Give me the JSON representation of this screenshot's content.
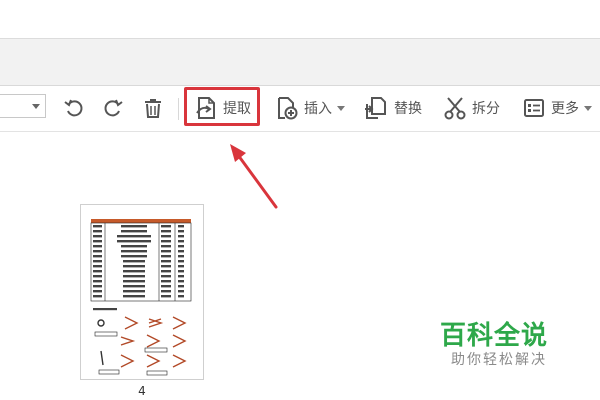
{
  "toolbar": {
    "extract_label": "提取",
    "insert_label": "插入",
    "replace_label": "替换",
    "split_label": "拆分",
    "more_label": "更多"
  },
  "thumbnail": {
    "page_number": "4"
  },
  "watermark": {
    "title": "百科全说",
    "subtitle": "助你轻松解决"
  },
  "colors": {
    "highlight": "#d9353c",
    "watermark_green": "#2ea84a"
  }
}
